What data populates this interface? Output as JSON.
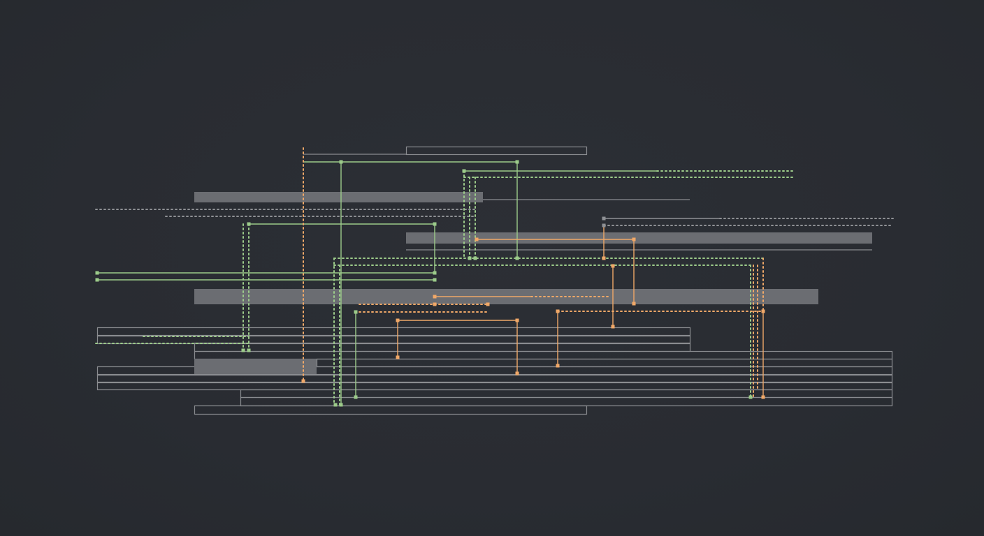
{
  "diagram": {
    "kind": "trace-timeline",
    "colors": {
      "background": "#2a2d33",
      "track_outline": "#8a8c90",
      "track_fill": "#6b6d72",
      "link_green": "#9ccb8a",
      "link_orange": "#f0a868",
      "link_gray": "#8f9195"
    },
    "text_labels": []
  }
}
